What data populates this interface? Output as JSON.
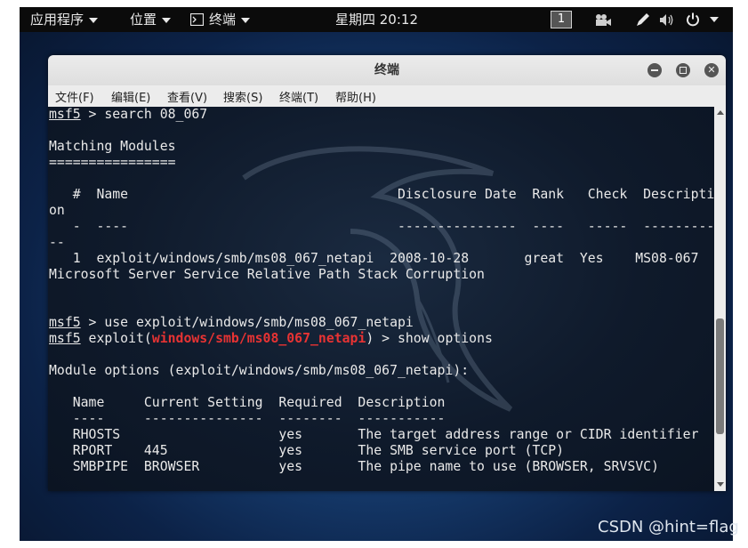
{
  "topbar": {
    "applications": "应用程序",
    "places": "位置",
    "terminal_app": "终端",
    "clock": "星期四 20:12",
    "workspace": "1"
  },
  "window": {
    "title": "终端",
    "menu": [
      "文件(F)",
      "编辑(E)",
      "查看(V)",
      "搜索(S)",
      "终端(T)",
      "帮助(H)"
    ]
  },
  "terminal": {
    "prompt": "msf5",
    "lines": [
      {
        "kind": "prompt",
        "text": " > search 08_067"
      },
      {
        "kind": "text",
        "text": ""
      },
      {
        "kind": "text",
        "text": "Matching Modules"
      },
      {
        "kind": "text",
        "text": "================"
      },
      {
        "kind": "text",
        "text": ""
      },
      {
        "kind": "text",
        "text": "   #  Name                                  Disclosure Date  Rank   Check  Descripti"
      },
      {
        "kind": "text",
        "text": "on"
      },
      {
        "kind": "text",
        "text": "   -  ----                                  ---------------  ----   -----  ---------"
      },
      {
        "kind": "text",
        "text": "--"
      },
      {
        "kind": "text",
        "text": "   1  exploit/windows/smb/ms08_067_netapi  2008-10-28       great  Yes    MS08-067"
      },
      {
        "kind": "text",
        "text": "Microsoft Server Service Relative Path Stack Corruption"
      },
      {
        "kind": "text",
        "text": ""
      },
      {
        "kind": "text",
        "text": ""
      },
      {
        "kind": "prompt",
        "text": " > use exploit/windows/smb/ms08_067_netapi"
      },
      {
        "kind": "module",
        "pre": " exploit(",
        "module": "windows/smb/ms08_067_netapi",
        "post": ") > show options"
      },
      {
        "kind": "text",
        "text": ""
      },
      {
        "kind": "text",
        "text": "Module options (exploit/windows/smb/ms08_067_netapi):"
      },
      {
        "kind": "text",
        "text": ""
      },
      {
        "kind": "text",
        "text": "   Name     Current Setting  Required  Description"
      },
      {
        "kind": "text",
        "text": "   ----     ---------------  --------  -----------"
      },
      {
        "kind": "text",
        "text": "   RHOSTS                    yes       The target address range or CIDR identifier"
      },
      {
        "kind": "text",
        "text": "   RPORT    445              yes       The SMB service port (TCP)"
      },
      {
        "kind": "text",
        "text": "   SMBPIPE  BROWSER          yes       The pipe name to use (BROWSER, SRVSVC)"
      }
    ]
  },
  "watermark": "CSDN @hint=flag"
}
